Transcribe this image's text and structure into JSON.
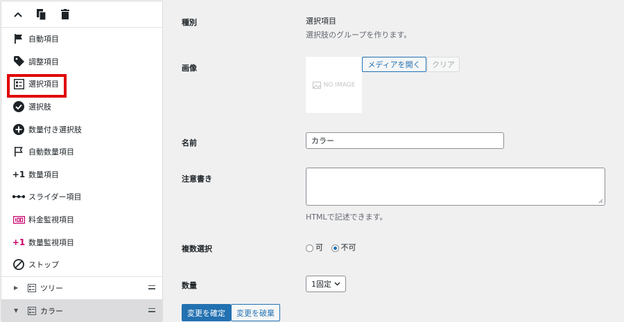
{
  "sidebar": {
    "menu": [
      {
        "label": "自動項目",
        "icon": "flag-icon"
      },
      {
        "label": "調整項目",
        "icon": "tag-icon"
      },
      {
        "label": "選択項目",
        "icon": "list-box-icon"
      },
      {
        "label": "選択肢",
        "icon": "check-circle-icon"
      },
      {
        "label": "数量付き選択肢",
        "icon": "plus-circle-icon"
      },
      {
        "label": "自動数量項目",
        "icon": "flag-outline-icon"
      },
      {
        "label": "数量項目",
        "icon": "plus-one-icon"
      },
      {
        "label": "スライダー項目",
        "icon": "slider-dots-icon"
      },
      {
        "label": "料金監視項目",
        "icon": "counter-icon"
      },
      {
        "label": "数量監視項目",
        "icon": "plus-one-pink-icon"
      },
      {
        "label": "ストップ",
        "icon": "stop-icon"
      }
    ],
    "tree": [
      {
        "label": "ツリー",
        "selected": false
      },
      {
        "label": "カラー",
        "selected": true
      }
    ],
    "highlight_color": "#e00000"
  },
  "form": {
    "type_label": "種別",
    "type_value": "選択項目",
    "type_desc": "選択肢のグループを作ります。",
    "image_label": "画像",
    "no_image_text": "NO IMAGE",
    "open_media_label": "メディアを開く",
    "clear_label": "クリア",
    "name_label": "名前",
    "name_value": "カラー",
    "note_label": "注意書き",
    "note_value": "",
    "note_hint": "HTMLで記述できます。",
    "multi_label": "複数選択",
    "multi_options": [
      "可",
      "不可"
    ],
    "multi_selected": "不可",
    "quantity_label": "数量",
    "quantity_value": "1固定",
    "confirm_label": "変更を確定",
    "discard_label": "変更を破棄"
  },
  "colors": {
    "accent": "#2271b1",
    "highlight": "#e00000",
    "pink": "#c9006b"
  }
}
